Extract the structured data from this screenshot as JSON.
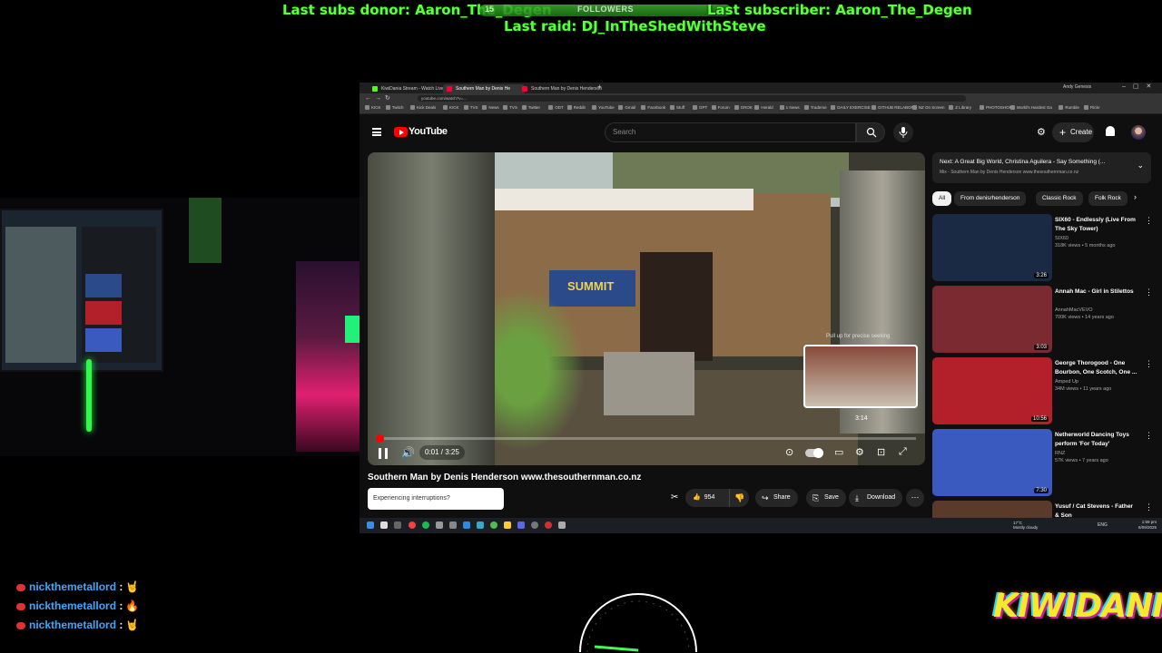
{
  "overlay": {
    "subs_donor": "Last subs donor: Aaron_The_Degen",
    "last_subscriber": "Last subscriber: Aaron_The_Degen",
    "last_raid": "Last raid: DJ_InTheShedWithSteve",
    "followers_label": "FOLLOWERS",
    "followers_count": "15",
    "logo": "KIWIDANIA"
  },
  "chat": [
    {
      "user": "nickthemetallord",
      "emoji": "🤘"
    },
    {
      "user": "nickthemetallord",
      "emoji": "🔥"
    },
    {
      "user": "nickthemetallord",
      "emoji": "🤘"
    }
  ],
  "browser": {
    "tabs": [
      {
        "title": "KiwiDania Stream - Watch Live",
        "color": "#53fc18"
      },
      {
        "title": "Southern Man by Denis He",
        "color": "#ff0033"
      },
      {
        "title": "Southern Man by Denis Henderson",
        "color": "#ff0033"
      }
    ],
    "url": "youtube.com/watch?v=...",
    "profile": "Andy Genesis",
    "bookmarks": [
      "KICK",
      "Twitch",
      "Kick Deals",
      "KICK",
      "TVS",
      "News",
      "TVS",
      "Twitter",
      "ODT",
      "Reddit",
      "YouTube",
      "Gmail",
      "Facebook",
      "Stuff",
      "GPT",
      "Forum",
      "GROK",
      "Herald",
      "1 News",
      "Trademe",
      "DAILY EXERCISE",
      "GITHUB RELABOR",
      "NZ On Screen",
      "Z Library",
      "PHOTOSHOP",
      "World's Hardest Ga",
      "Rumble",
      "Flickr",
      "All Bookmarks"
    ]
  },
  "youtube": {
    "logo_text": "YouTube",
    "search_placeholder": "Search",
    "create_label": "Create",
    "video": {
      "seek_hint": "Pull up for precise seeking",
      "seek_time": "3:14",
      "current_time": "0:01",
      "duration": "3:25",
      "time_display": "0:01 / 3:25",
      "progress": 0.005,
      "sign_text": "SUMMIT"
    },
    "title": "Southern Man by Denis Henderson www.thesouthernman.co.nz",
    "interruption_prompt": "Experiencing interruptions?",
    "like_count": "954",
    "share_label": "Share",
    "save_label": "Save",
    "download_label": "Download",
    "next_up": {
      "title": "Next: A Great Big World, Christina Aguilera - Say Something (...",
      "subtitle": "Mix - Southern Man by Denis Henderson www.thesouthernman.co.nz"
    },
    "chips": [
      "All",
      "From denisrhenderson",
      "Classic Rock",
      "Folk Rock"
    ],
    "recommendations": [
      {
        "title": "SIX60 - Endlessly (Live From The Sky Tower)",
        "channel": "SIX60",
        "meta": "318K views • 5 months ago",
        "duration": "3:26",
        "thumb": "#1a2a44"
      },
      {
        "title": "Annah Mac - Girl in Stilettos",
        "channel": "AnnahMacVEVO",
        "meta": "700K views • 14 years ago",
        "duration": "3:03",
        "thumb": "#7a2a30"
      },
      {
        "title": "George Thorogood - One Bourbon, One Scotch, One ...",
        "channel": "Amped Up",
        "meta": "34M views • 11 years ago",
        "duration": "10:56",
        "thumb": "#b3202a"
      },
      {
        "title": "Netherworld Dancing Toys perform 'For Today'",
        "channel": "RNZ",
        "meta": "57K views • 7 years ago",
        "duration": "7:30",
        "thumb": "#3a5ac0"
      },
      {
        "title": "Yusuf / Cat Stevens - Father & Son",
        "channel": "",
        "meta": "",
        "duration": "",
        "thumb": "#5a3a2a"
      }
    ]
  },
  "taskbar": {
    "weather_temp": "17°C",
    "weather_text": "Mostly cloudy",
    "lang": "ENG",
    "time": "1:59 pm",
    "date": "6/09/2025"
  },
  "colors": {
    "overlay_green": "#5dff3c",
    "youtube_red": "#ff0000",
    "chat_name": "#3aa8ff"
  }
}
